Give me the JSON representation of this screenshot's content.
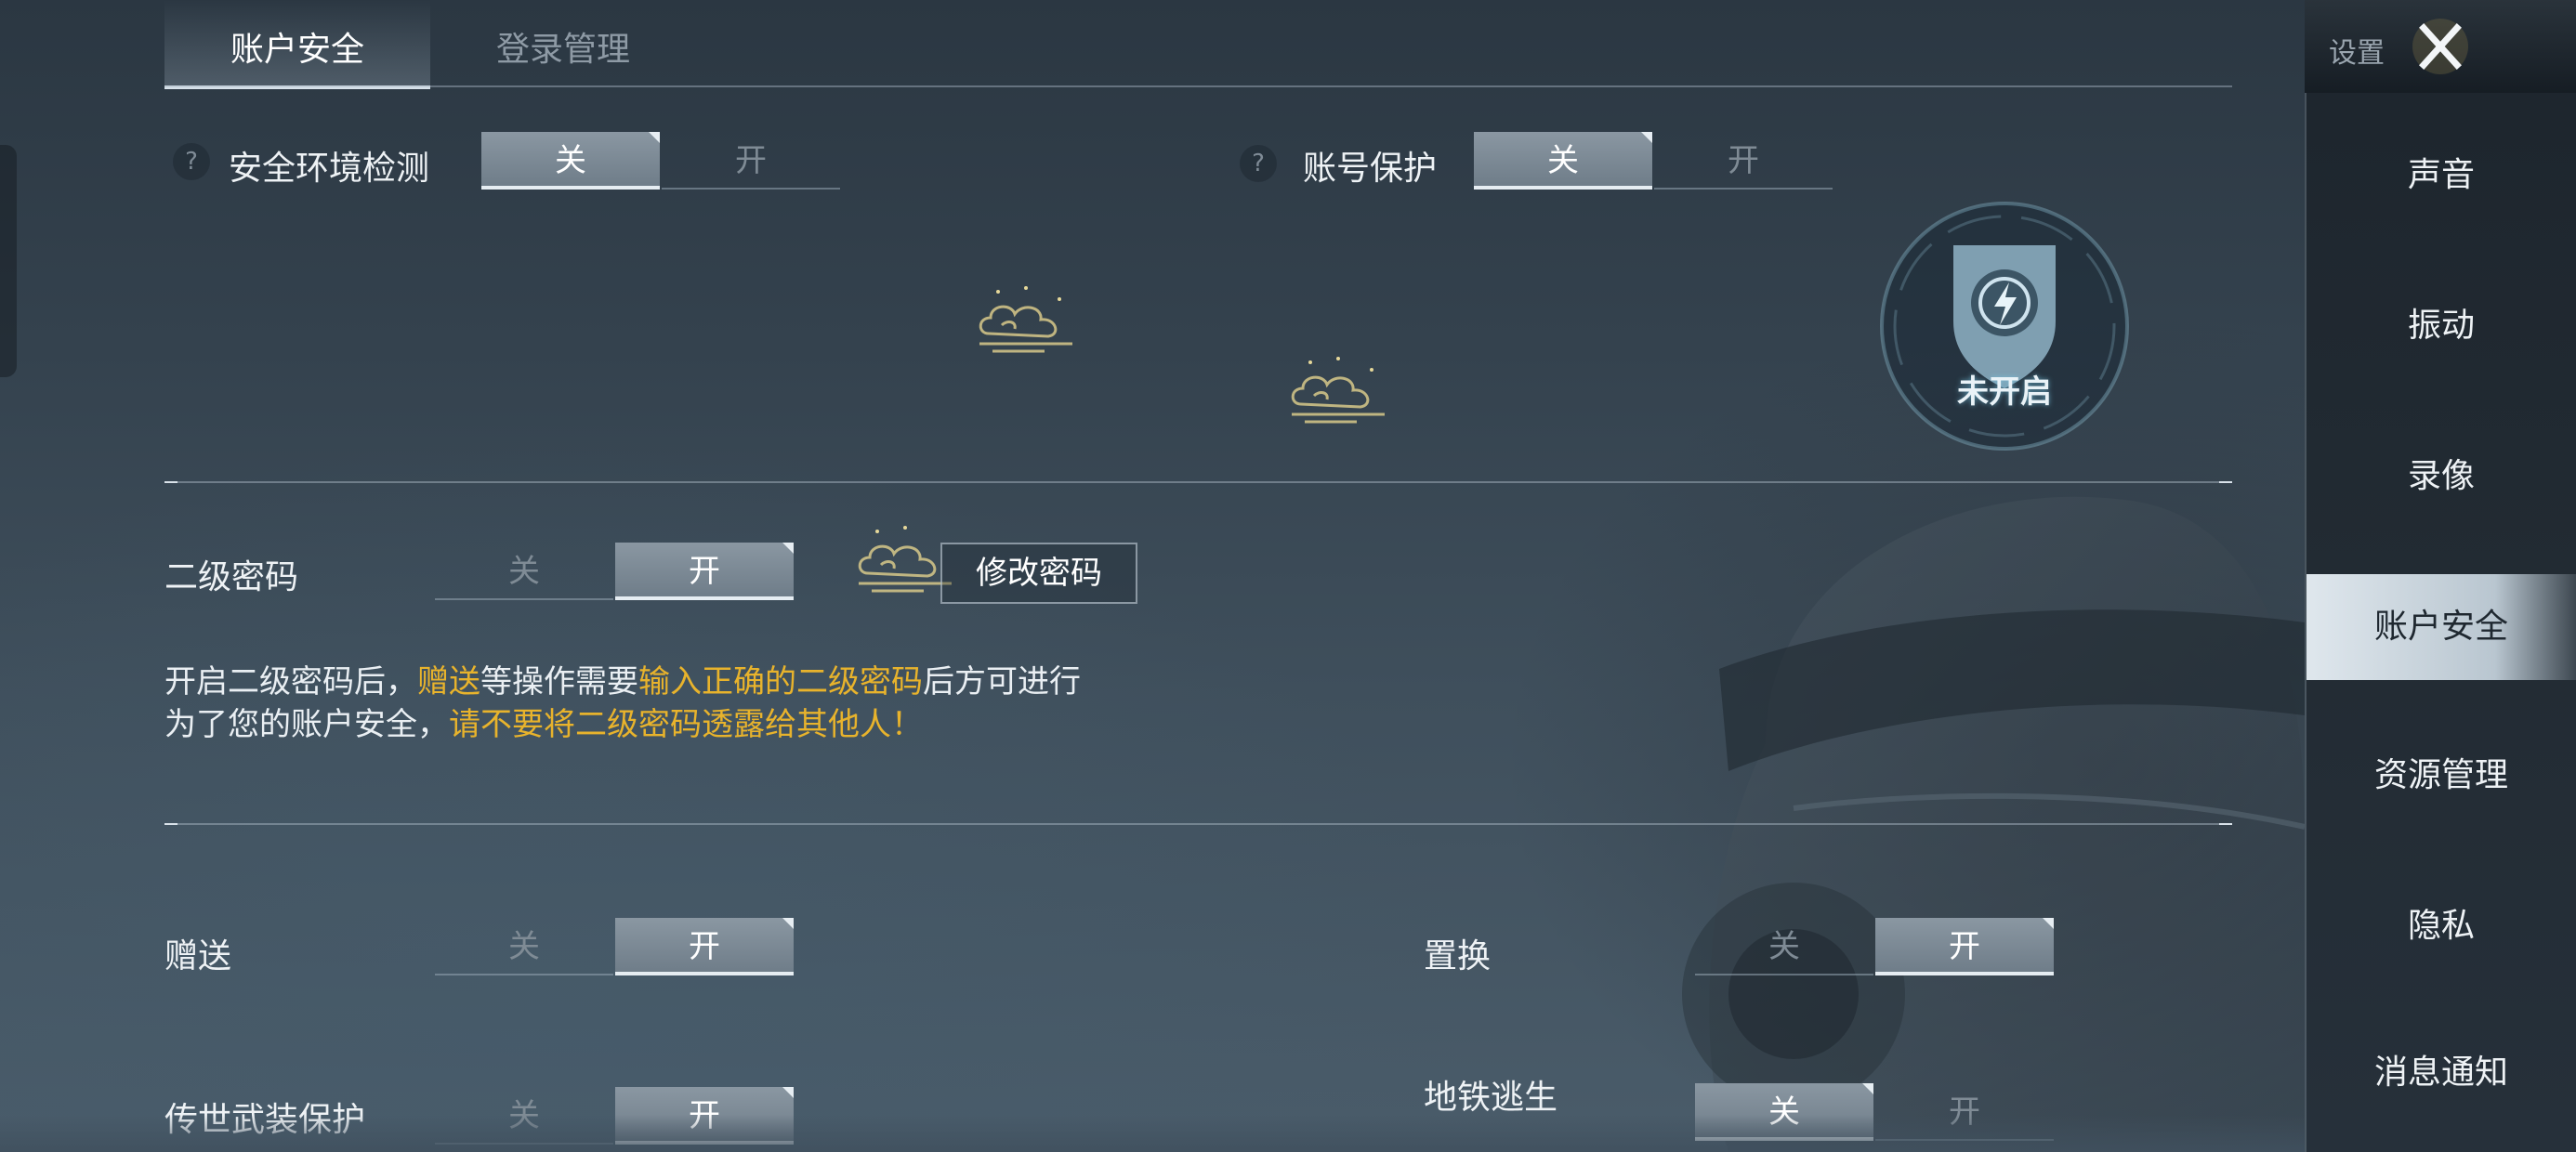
{
  "top_tabs": [
    {
      "label": "账户安全",
      "active": true
    },
    {
      "label": "登录管理",
      "active": false
    }
  ],
  "rows": {
    "env_check": {
      "help": "?",
      "label": "安全环境检测",
      "off": "关",
      "on": "开",
      "state": "关"
    },
    "account_protect": {
      "help": "?",
      "label": "账号保护",
      "off": "关",
      "on": "开",
      "state": "关"
    },
    "second_password": {
      "label": "二级密码",
      "off": "关",
      "on": "开",
      "state": "开",
      "change_button": "修改密码"
    },
    "gift": {
      "label": "赠送",
      "off": "关",
      "on": "开",
      "state": "开"
    },
    "exchange": {
      "label": "置换",
      "off": "关",
      "on": "开",
      "state": "开"
    },
    "legend_weapon": {
      "label": "传世武装保护",
      "off": "关",
      "on": "开",
      "state": "开"
    },
    "metro": {
      "label": "地铁逃生",
      "off": "关",
      "on": "开",
      "state": "关"
    }
  },
  "info": {
    "line1": [
      {
        "text": "开启二级密码后，",
        "highlight": false
      },
      {
        "text": "赠送",
        "highlight": true
      },
      {
        "text": "等操作需要",
        "highlight": false
      },
      {
        "text": "输入正确的二级密码",
        "highlight": true
      },
      {
        "text": "后方可进行",
        "highlight": false
      }
    ],
    "line2": [
      {
        "text": "为了您的账户安全，",
        "highlight": false
      },
      {
        "text": "请不要将二级密码透露给其他人！",
        "highlight": true
      }
    ]
  },
  "shield": {
    "status": "未开启",
    "icon": "lightning-shield-icon"
  },
  "sidebar": {
    "title": "设置",
    "close_icon": "close-icon",
    "items": [
      {
        "label": "声音",
        "active": false
      },
      {
        "label": "振动",
        "active": false
      },
      {
        "label": "录像",
        "active": false
      },
      {
        "label": "账户安全",
        "active": true
      },
      {
        "label": "资源管理",
        "active": false
      },
      {
        "label": "隐私",
        "active": false
      },
      {
        "label": "消息通知",
        "active": false
      }
    ]
  },
  "colors": {
    "highlight": "#e8b32c",
    "text": "#eef2f5",
    "toggle_on": "#7f8c97"
  }
}
